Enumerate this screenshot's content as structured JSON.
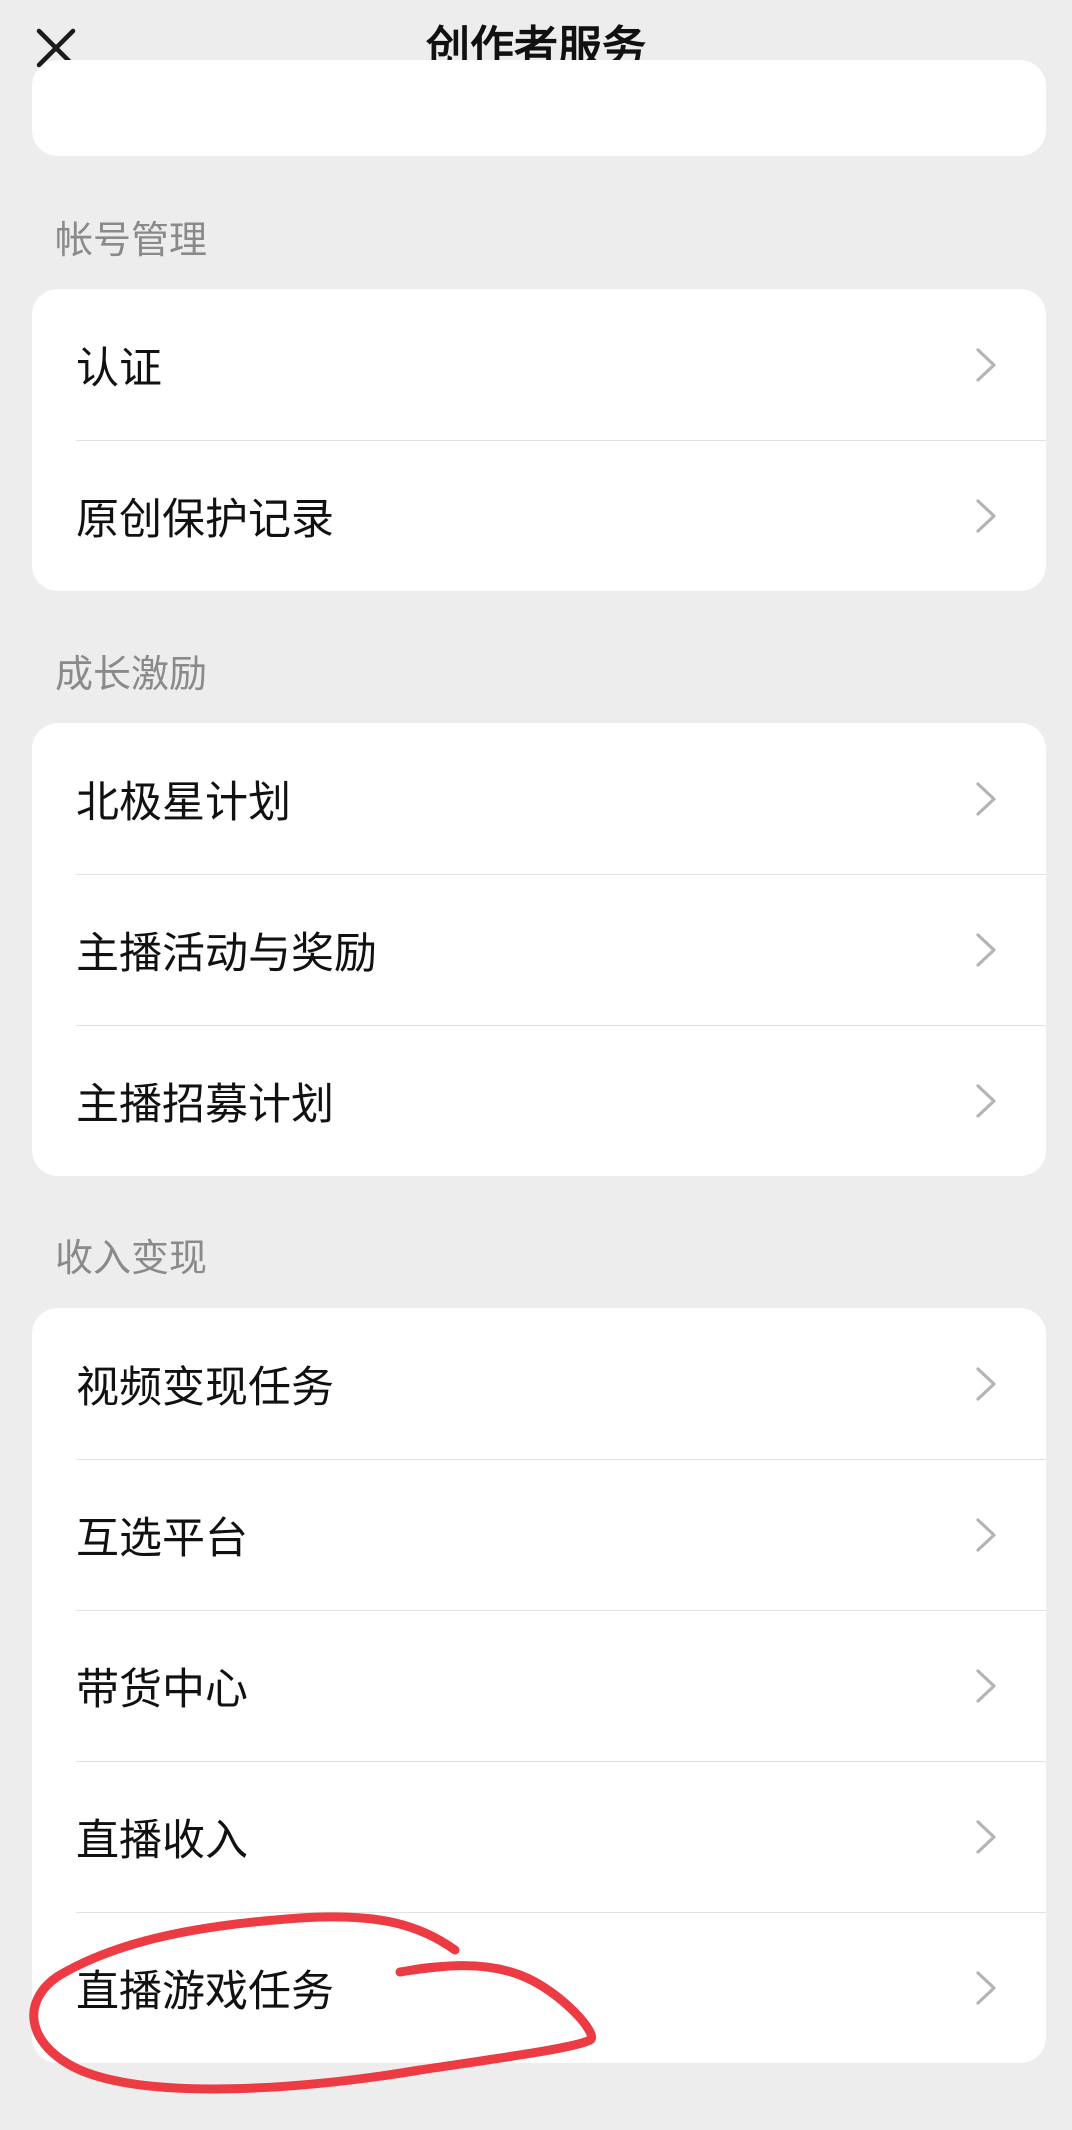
{
  "header": {
    "title": "创作者服务",
    "close_icon": "close-icon"
  },
  "sections": [
    {
      "label": "帐号管理",
      "items": [
        {
          "label": "认证"
        },
        {
          "label": "原创保护记录"
        }
      ]
    },
    {
      "label": "成长激励",
      "items": [
        {
          "label": "北极星计划"
        },
        {
          "label": "主播活动与奖励"
        },
        {
          "label": "主播招募计划"
        }
      ]
    },
    {
      "label": "收入变现",
      "items": [
        {
          "label": "视频变现任务"
        },
        {
          "label": "互选平台"
        },
        {
          "label": "带货中心"
        },
        {
          "label": "直播收入"
        },
        {
          "label": "直播游戏任务"
        }
      ]
    }
  ],
  "colors": {
    "background": "#ededed",
    "card": "#ffffff",
    "section_label": "#8a8a8a",
    "chevron": "#b4b4b4",
    "annotation": "#ec3b42"
  },
  "icons": {
    "row_chevron": "chevron-right-icon"
  }
}
